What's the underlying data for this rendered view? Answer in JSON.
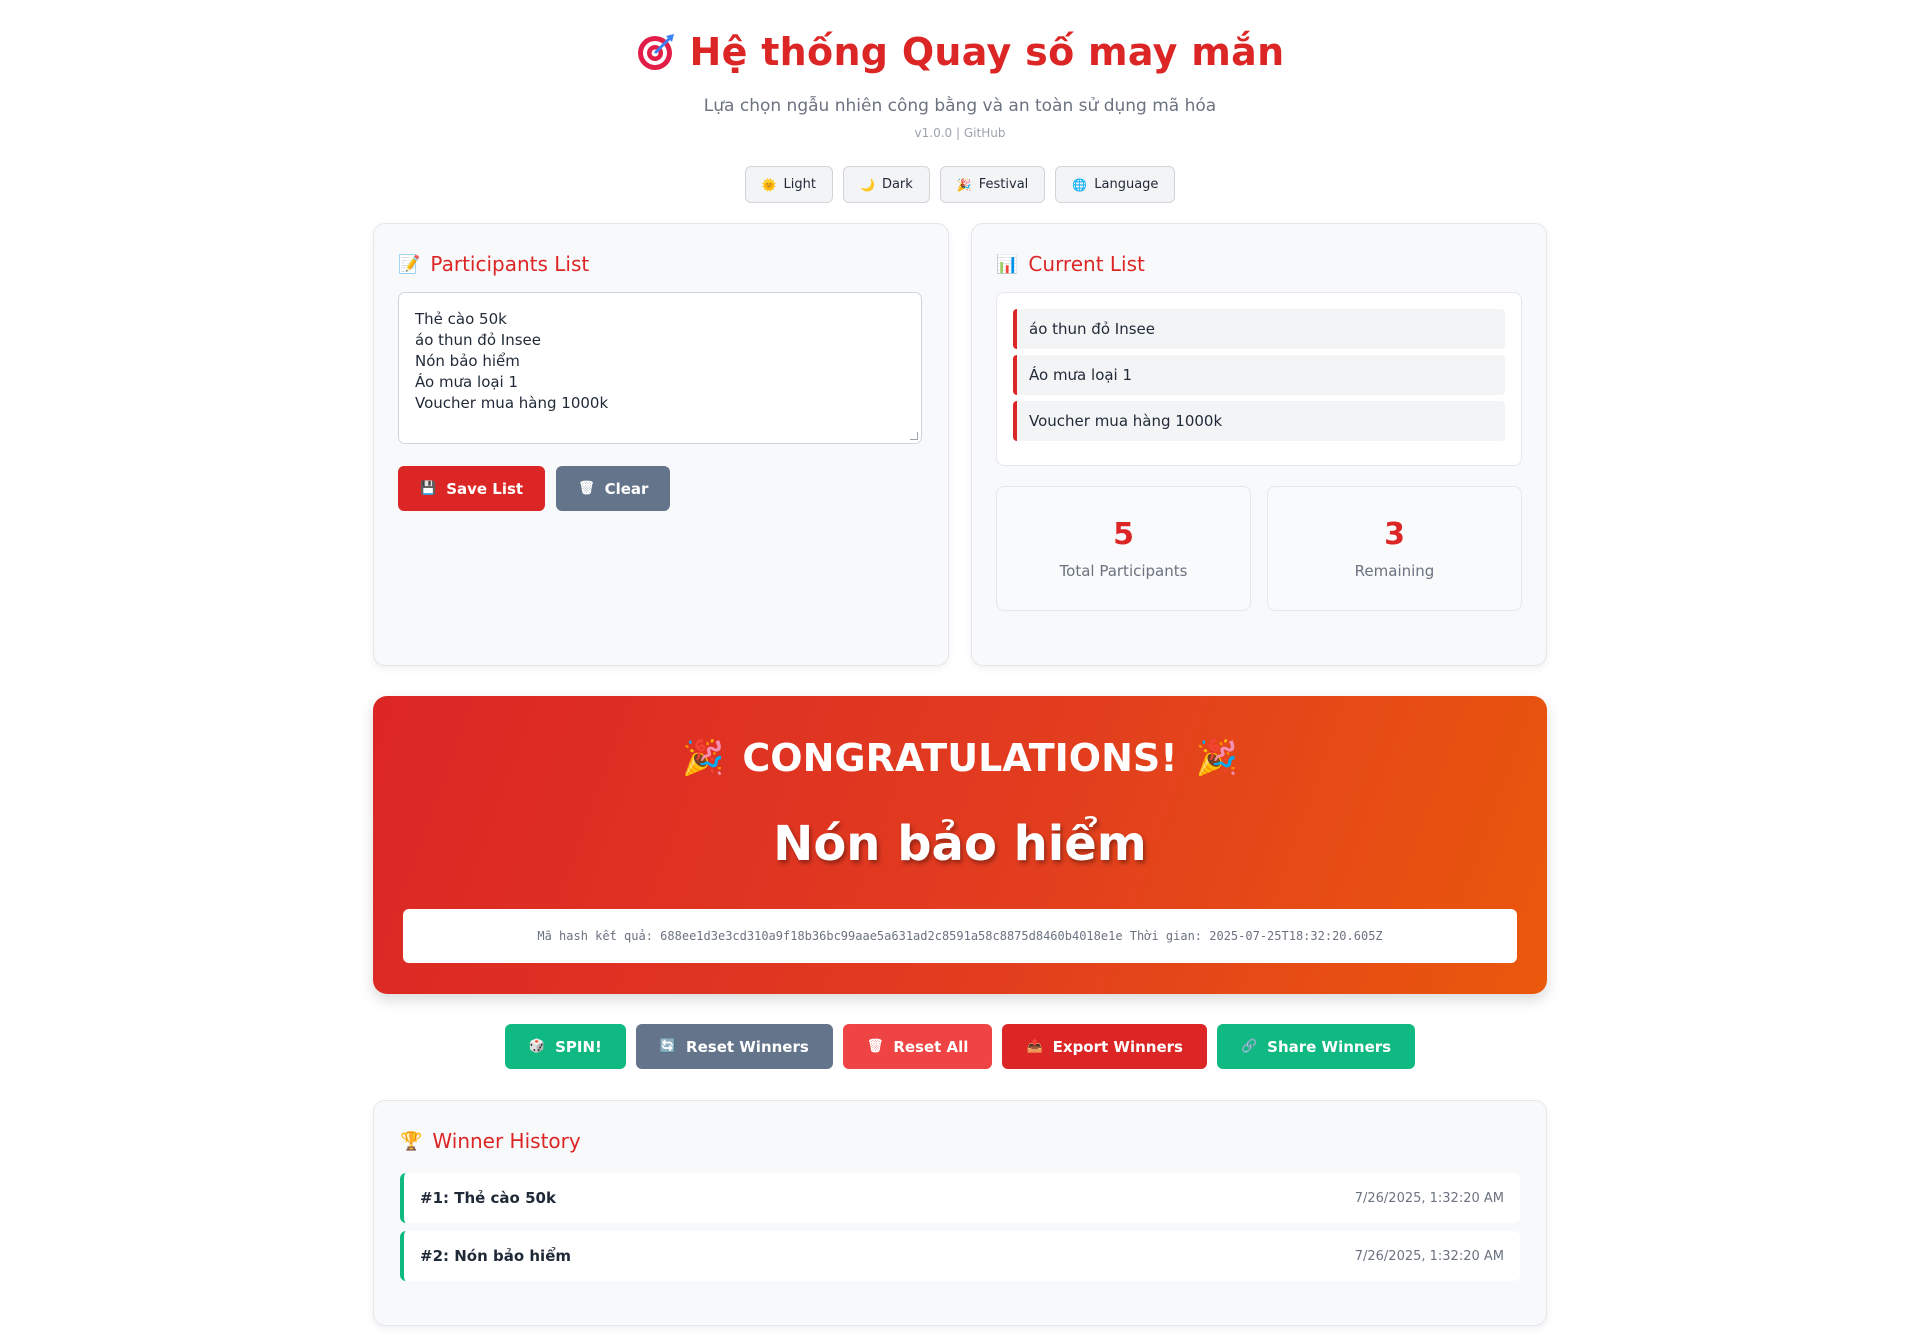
{
  "header": {
    "title": "Hệ thống Quay số may mắn",
    "subtitle": "Lựa chọn ngẫu nhiên công bằng và an toàn sử dụng mã hóa",
    "version": "v1.0.0 | GitHub"
  },
  "themes": [
    {
      "label": "Light",
      "icon": "sun-icon"
    },
    {
      "label": "Dark",
      "icon": "moon-icon"
    },
    {
      "label": "Festival",
      "icon": "party-icon"
    },
    {
      "label": "Language",
      "icon": "globe-icon"
    }
  ],
  "participants": {
    "heading": "Participants List",
    "textarea_value": "Thẻ cào 50k\náo thun đỏ Insee\nNón bảo hiểm\nÁo mưa loại 1\nVoucher mua hàng 1000k",
    "save_label": "Save List",
    "clear_label": "Clear"
  },
  "current": {
    "heading": "Current List",
    "items": [
      "áo thun đỏ Insee",
      "Áo mưa loại 1",
      "Voucher mua hàng 1000k"
    ],
    "total_value": "5",
    "total_label": "Total Participants",
    "remaining_value": "3",
    "remaining_label": "Remaining"
  },
  "result": {
    "congrats": "CONGRATULATIONS!",
    "winner": "Nón bảo hiểm",
    "hash_text": "Mã hash kết quả: 688ee1d3e3cd310a9f18b36bc99aae5a631ad2c8591a58c8875d8460b4018e1e Thời gian: 2025-07-25T18:32:20.605Z"
  },
  "actions": {
    "spin": "SPIN!",
    "reset_winners": "Reset Winners",
    "reset_all": "Reset All",
    "export": "Export Winners",
    "share": "Share Winners"
  },
  "history": {
    "heading": "Winner History",
    "items": [
      {
        "name": "#1: Thẻ cào 50k",
        "time": "7/26/2025, 1:32:20 AM"
      },
      {
        "name": "#2: Nón bảo hiểm",
        "time": "7/26/2025, 1:32:20 AM"
      }
    ]
  },
  "colors": {
    "accent": "#dc2626",
    "success": "#10b981",
    "neutral": "#64748b",
    "orange": "#ea580c"
  }
}
